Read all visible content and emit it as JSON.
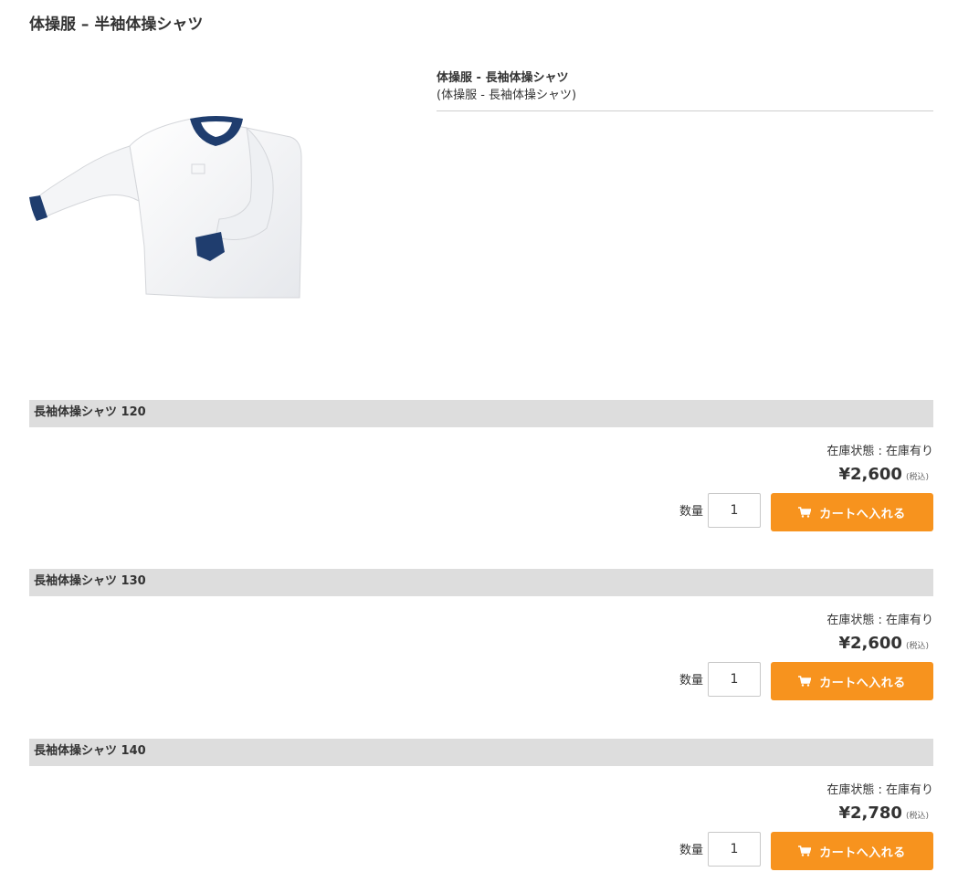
{
  "page": {
    "title": "体操服 – 半袖体操シャツ"
  },
  "product": {
    "name": "体操服 - 長袖体操シャツ",
    "subtitle": "(体操服 - 長袖体操シャツ)",
    "image_icon": "long-sleeve-gym-shirt-image"
  },
  "colors": {
    "accent": "#f7931e",
    "variant_bar": "#dddddd",
    "shirt_collar": "#1f3d6e"
  },
  "variants": [
    {
      "name": "長袖体操シャツ 120",
      "stock": "在庫状態 : 在庫有り",
      "price": "¥2,600",
      "tax": "(税込)",
      "qty_label": "数量",
      "qty_value": "1",
      "cart_label": "カートへ入れる",
      "cart_icon": "shopping-cart-icon"
    },
    {
      "name": "長袖体操シャツ 130",
      "stock": "在庫状態 : 在庫有り",
      "price": "¥2,600",
      "tax": "(税込)",
      "qty_label": "数量",
      "qty_value": "1",
      "cart_label": "カートへ入れる",
      "cart_icon": "shopping-cart-icon"
    },
    {
      "name": "長袖体操シャツ 140",
      "stock": "在庫状態 : 在庫有り",
      "price": "¥2,780",
      "tax": "(税込)",
      "qty_label": "数量",
      "qty_value": "1",
      "cart_label": "カートへ入れる",
      "cart_icon": "shopping-cart-icon"
    }
  ]
}
